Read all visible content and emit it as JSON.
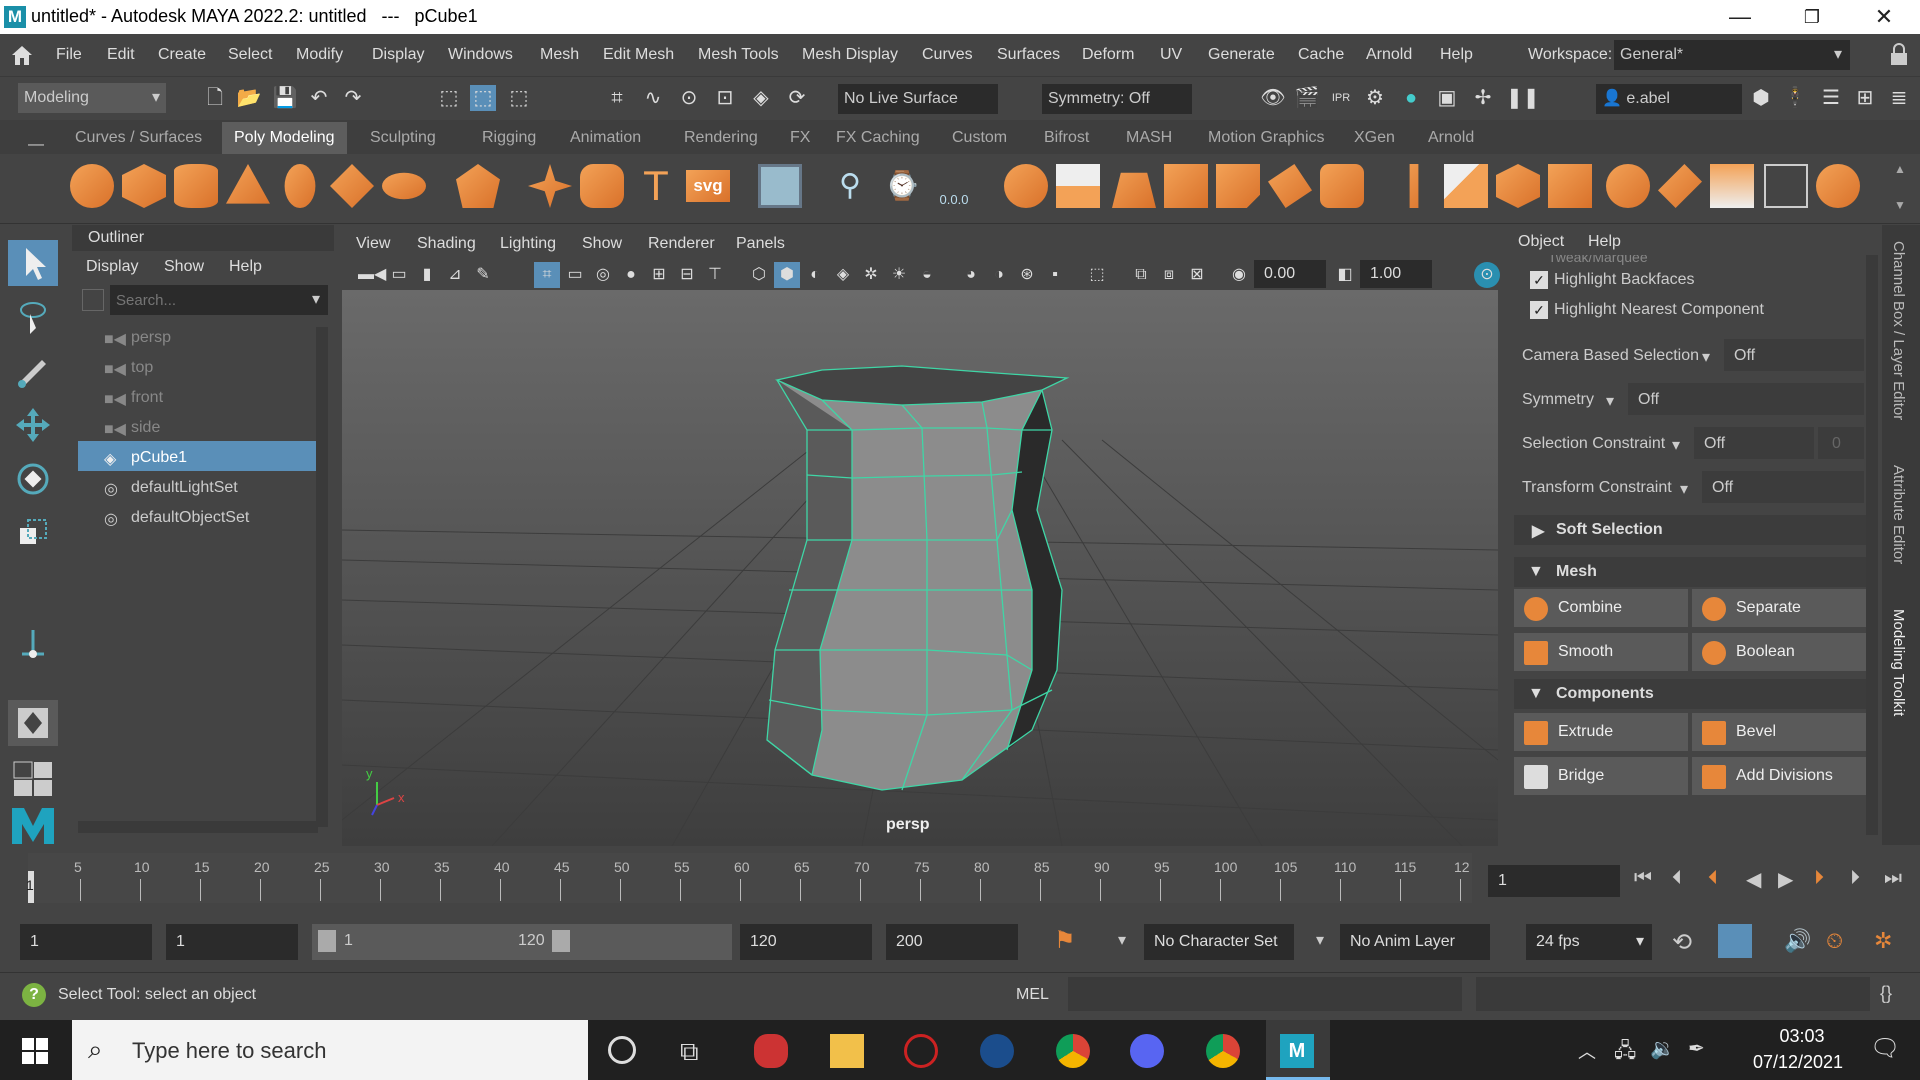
{
  "titlebar": {
    "logo": "M",
    "title": "untitled* - Autodesk MAYA 2022.2: untitled   ---   pCube1",
    "minimize": "—",
    "restore": "❐",
    "close": "✕"
  },
  "menubar": {
    "items": [
      "File",
      "Edit",
      "Create",
      "Select",
      "Modify",
      "Display",
      "Windows",
      "Mesh",
      "Edit Mesh",
      "Mesh Tools",
      "Mesh Display",
      "Curves",
      "Surfaces",
      "Deform",
      "UV",
      "Generate",
      "Cache",
      "Arnold",
      "Help"
    ],
    "workspace_label": "Workspace:",
    "workspace_value": "General*"
  },
  "statusline": {
    "mode": "Modeling",
    "live_surface": "No Live Surface",
    "symmetry": "Symmetry: Off",
    "user": "e.abel"
  },
  "shelf": {
    "tabs": [
      "Curves / Surfaces",
      "Poly Modeling",
      "Sculpting",
      "Rigging",
      "Animation",
      "Rendering",
      "FX",
      "FX Caching",
      "Custom",
      "Bifrost",
      "MASH",
      "Motion Graphics",
      "XGen",
      "Arnold"
    ],
    "active_tab": "Poly Modeling",
    "svg_label": "svg",
    "t_label": "T",
    "snap_value": "0.0.0"
  },
  "outliner": {
    "title": "Outliner",
    "menu": [
      "Display",
      "Show",
      "Help"
    ],
    "search_placeholder": "Search...",
    "items": [
      "persp",
      "top",
      "front",
      "side",
      "pCube1",
      "defaultLightSet",
      "defaultObjectSet"
    ],
    "selected": "pCube1"
  },
  "viewport": {
    "menu": [
      "View",
      "Shading",
      "Lighting",
      "Show",
      "Renderer",
      "Panels"
    ],
    "field1": "0.00",
    "field2": "1.00",
    "camera_label": "persp",
    "axis_y": "y",
    "axis_x": "x"
  },
  "channel": {
    "menu": [
      "Object",
      "Help"
    ],
    "tweak": "Tweak/Marquee",
    "highlight_backfaces": "Highlight Backfaces",
    "highlight_nearest": "Highlight Nearest Component",
    "camera_based_label": "Camera Based Selection",
    "camera_based_value": "Off",
    "symmetry_label": "Symmetry",
    "symmetry_value": "Off",
    "sel_constraint_label": "Selection Constraint",
    "sel_constraint_value": "Off",
    "sel_constraint_num": "0",
    "transform_constraint_label": "Transform Constraint",
    "transform_constraint_value": "Off",
    "soft_selection": "Soft Selection",
    "mesh_section": "Mesh",
    "combine": "Combine",
    "separate": "Separate",
    "smooth": "Smooth",
    "boolean": "Boolean",
    "components_section": "Components",
    "extrude": "Extrude",
    "bevel": "Bevel",
    "bridge": "Bridge",
    "add_divisions": "Add Divisions",
    "side_tabs": [
      "Channel Box / Layer Editor",
      "Attribute Editor",
      "Modeling Toolkit"
    ]
  },
  "timeslider": {
    "ticks": [
      "5",
      "10",
      "15",
      "20",
      "25",
      "30",
      "35",
      "40",
      "45",
      "50",
      "55",
      "60",
      "65",
      "70",
      "75",
      "80",
      "85",
      "90",
      "95",
      "100",
      "105",
      "110",
      "115",
      "12"
    ],
    "start_tick": "1",
    "current_frame": "1"
  },
  "rangebar": {
    "start": "1",
    "playback_start": "1",
    "range_start": "1",
    "range_end": "120",
    "playback_end": "120",
    "end": "200",
    "character_set": "No Character Set",
    "anim_layer": "No Anim Layer",
    "fps": "24 fps"
  },
  "helpline": {
    "text": "Select Tool: select an object",
    "mel_label": "MEL"
  },
  "taskbar": {
    "search_placeholder": "Type here to search",
    "time": "03:03",
    "date": "07/12/2021"
  }
}
